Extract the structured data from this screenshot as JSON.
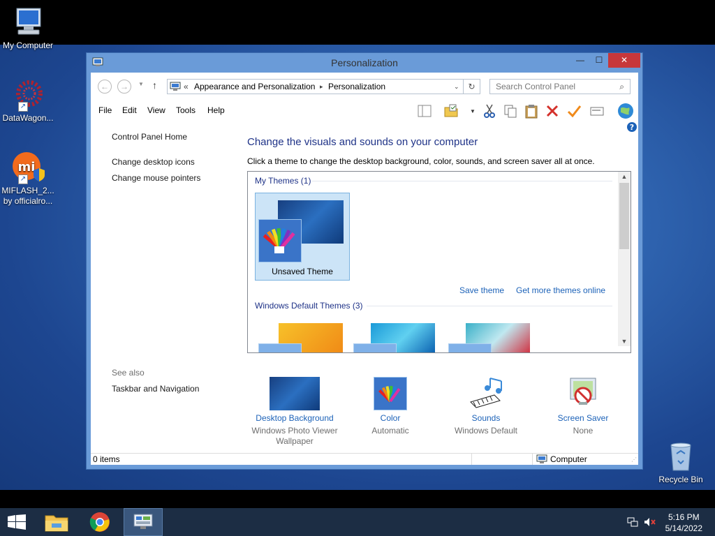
{
  "desktop": {
    "icons": [
      {
        "label": "My Computer"
      },
      {
        "label": "DataWagon..."
      },
      {
        "label_line1": "MIFLASH_2...",
        "label_line2": "by officialro..."
      },
      {
        "label": "Recycle Bin"
      }
    ]
  },
  "window": {
    "title": "Personalization",
    "controls": {
      "minimize": "—",
      "maximize": "☐",
      "close": "✕"
    }
  },
  "address": {
    "chevron": "«",
    "crumbs": [
      "Appearance and Personalization",
      "Personalization"
    ],
    "separator": "▸",
    "search_placeholder": "Search Control Panel"
  },
  "menu": [
    "File",
    "Edit",
    "View",
    "Tools",
    "Help"
  ],
  "left_pane": {
    "home": "Control Panel Home",
    "links": [
      "Change desktop icons",
      "Change mouse pointers"
    ],
    "see_also": "See also",
    "see_also_links": [
      "Taskbar and Navigation"
    ]
  },
  "main": {
    "title": "Change the visuals and sounds on your computer",
    "description": "Click a theme to change the desktop background, color, sounds, and screen saver all at once.",
    "my_themes_header": "My Themes (1)",
    "unsaved_theme": "Unsaved Theme",
    "save_theme": "Save theme",
    "get_more_themes": "Get more themes online",
    "default_themes_header": "Windows Default Themes (3)"
  },
  "settings": [
    {
      "label": "Desktop Background",
      "value_line1": "Windows Photo Viewer",
      "value_line2": "Wallpaper"
    },
    {
      "label": "Color",
      "value_line1": "Automatic"
    },
    {
      "label": "Sounds",
      "value_line1": "Windows Default"
    },
    {
      "label": "Screen Saver",
      "value_line1": "None"
    }
  ],
  "status_bar": {
    "items": "0 items",
    "location": "Computer"
  },
  "taskbar": {
    "time": "5:16 PM",
    "date": "5/14/2022"
  },
  "colors": {
    "link": "#1c62b8",
    "heading": "#1e3287",
    "close_button": "#c7373b",
    "taskbar": "#1c2d44"
  }
}
